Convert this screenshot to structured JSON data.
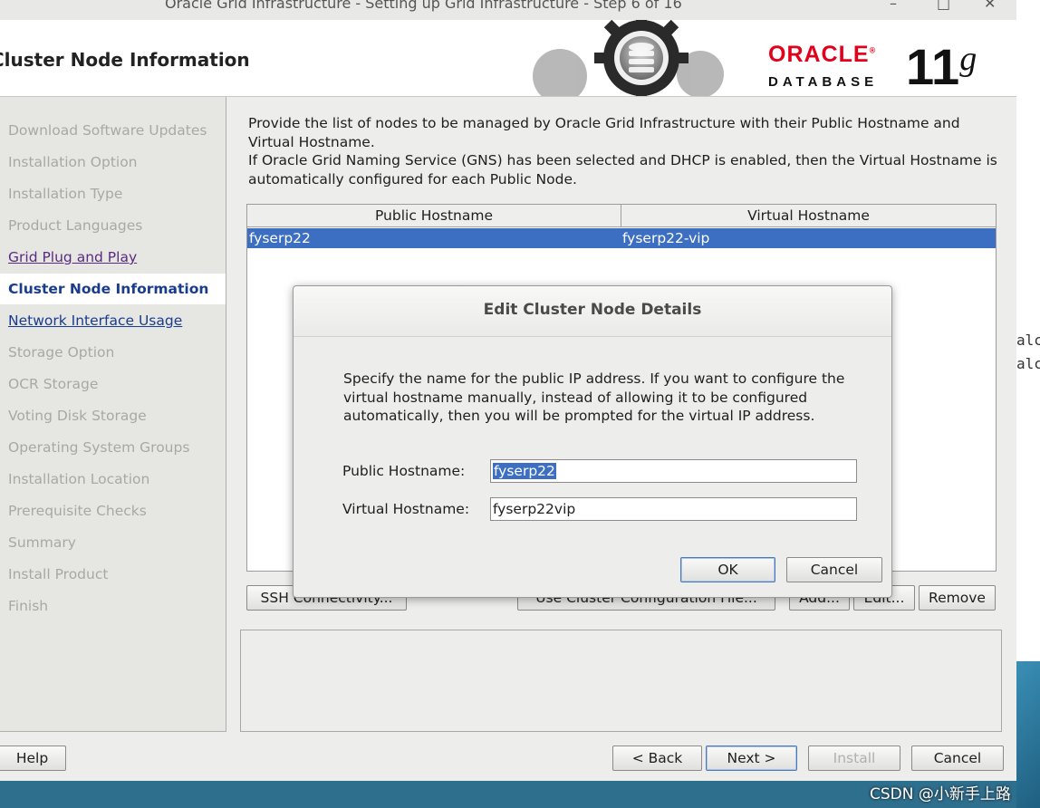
{
  "window": {
    "title": "Oracle Grid Infrastructure - Setting up Grid Infrastructure - Step 6 of 16",
    "minimize": "–",
    "maximize": "□",
    "close": "✕"
  },
  "header": {
    "page_title": "Cluster Node Information",
    "logo_oracle": "ORACLE",
    "logo_reg": "®",
    "logo_database": "DATABASE",
    "logo_version": "11",
    "logo_version_suffix": "g"
  },
  "sidebar": {
    "steps": [
      {
        "label": "Download Software Updates",
        "state": "disabled"
      },
      {
        "label": "Installation Option",
        "state": "disabled"
      },
      {
        "label": "Installation Type",
        "state": "disabled"
      },
      {
        "label": "Product Languages",
        "state": "disabled"
      },
      {
        "label": "Grid Plug and Play",
        "state": "visited"
      },
      {
        "label": "Cluster Node Information",
        "state": "current"
      },
      {
        "label": "Network Interface Usage",
        "state": "link"
      },
      {
        "label": "Storage Option",
        "state": "disabled"
      },
      {
        "label": "OCR Storage",
        "state": "disabled"
      },
      {
        "label": "Voting Disk Storage",
        "state": "disabled"
      },
      {
        "label": "Operating System Groups",
        "state": "disabled"
      },
      {
        "label": "Installation Location",
        "state": "disabled"
      },
      {
        "label": "Prerequisite Checks",
        "state": "disabled"
      },
      {
        "label": "Summary",
        "state": "disabled"
      },
      {
        "label": "Install Product",
        "state": "disabled"
      },
      {
        "label": "Finish",
        "state": "disabled"
      }
    ]
  },
  "main": {
    "description_1": "Provide the list of nodes to be managed by Oracle Grid Infrastructure with their Public Hostname and Virtual Hostname.",
    "description_2": "If Oracle Grid Naming Service (GNS) has been selected and DHCP is enabled, then the Virtual Hostname is automatically configured for each Public Node.",
    "table": {
      "columns": [
        "Public Hostname",
        "Virtual Hostname"
      ],
      "rows": [
        [
          "fyserp22",
          "fyserp22-vip"
        ]
      ]
    },
    "buttons": {
      "ssh": "SSH Connectivity...",
      "use_cluster": "Use Cluster Configuration File...",
      "add": "Add...",
      "edit": "Edit...",
      "remove": "Remove"
    }
  },
  "footer": {
    "help": "Help",
    "back": "< Back",
    "next": "Next >",
    "install": "Install",
    "cancel": "Cancel"
  },
  "dialog": {
    "title": "Edit Cluster Node Details",
    "text": "Specify the name for the public IP address. If you want to configure the virtual hostname manually, instead of allowing it to be configured automatically, then you will be prompted for the virtual IP address.",
    "public_label": "Public Hostname:",
    "public_value": "fyserp22",
    "virtual_label": "Virtual Hostname:",
    "virtual_value": "fyserp22vip",
    "ok": "OK",
    "cancel": "Cancel"
  },
  "desktop": {
    "text_line1": "alc",
    "text_line2": "alc",
    "watermark": "CSDN @小新手上路"
  }
}
